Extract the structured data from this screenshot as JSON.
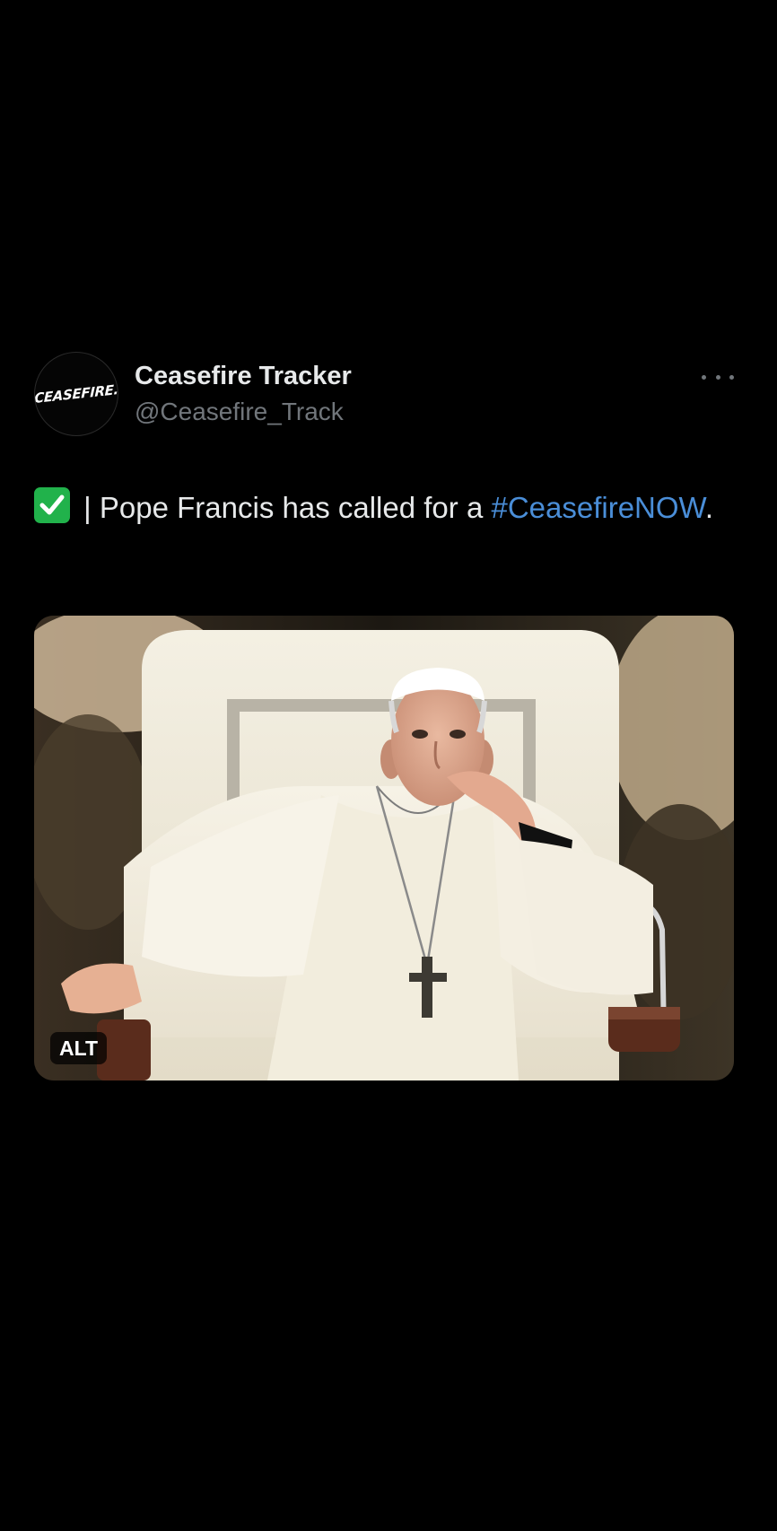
{
  "author": {
    "avatar_text": "CEASEFIRE.",
    "display_name": "Ceasefire Tracker",
    "handle": "@Ceasefire_Track"
  },
  "tweet": {
    "text_before": " | Pope Francis has called for a ",
    "hashtag": "#CeasefireNOW",
    "text_after": "."
  },
  "media": {
    "alt_badge": "ALT"
  },
  "icons": {
    "check": "check-mark-button-icon",
    "more": "more-options-icon"
  },
  "colors": {
    "background": "#000000",
    "name": "#e7e9ea",
    "handle": "#71767b",
    "hashtag": "#4a8ed8",
    "check": "#21b24b"
  }
}
